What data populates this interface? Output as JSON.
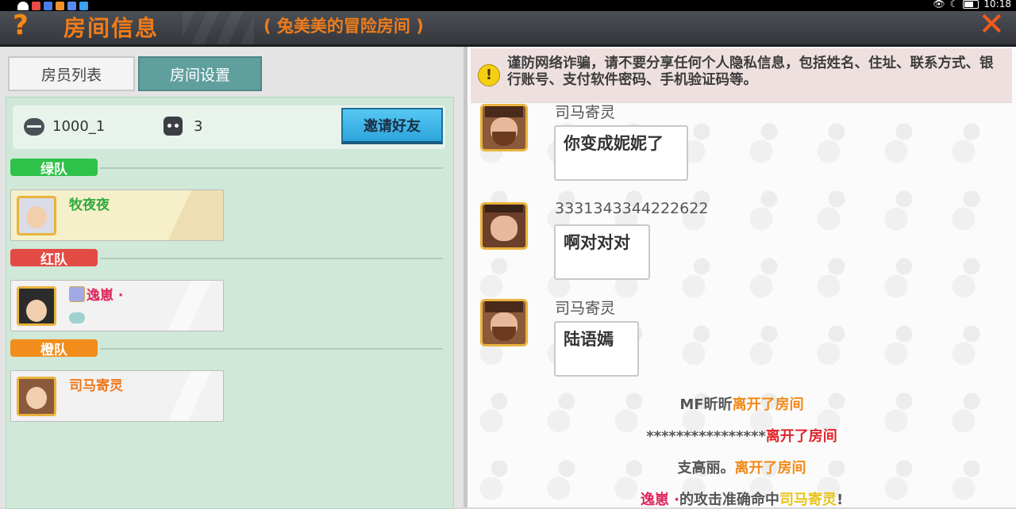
{
  "status_bar": {
    "time": "10:18"
  },
  "header": {
    "help_symbol": "?",
    "title": "房间信息",
    "subtitle": "( 兔美美的冒险房间 )",
    "close_symbol": "✕"
  },
  "tabs": [
    {
      "label": "房员列表",
      "active": false
    },
    {
      "label": "房间设置",
      "active": true
    }
  ],
  "room": {
    "room_id": "1000_1",
    "player_count": "3",
    "invite_label": "邀请好友"
  },
  "teams": [
    {
      "label": "绿队",
      "color": "#2fc24a",
      "members": [
        {
          "name": "牧夜夜",
          "name_color": "#2fa83d"
        }
      ]
    },
    {
      "label": "红队",
      "color": "#e34b45",
      "members": [
        {
          "name": "逸崽 ·",
          "name_color": "#e0245a"
        }
      ]
    },
    {
      "label": "橙队",
      "color": "#f28c1a",
      "members": [
        {
          "name": "司马寄灵",
          "name_color": "#f0781c"
        }
      ]
    }
  ],
  "chat": {
    "warning_icon": "!",
    "warning": "谨防网络诈骗，请不要分享任何个人隐私信息，包括姓名、住址、联系方式、银行账号、支付软件密码、手机验证码等。",
    "messages": [
      {
        "sender": "司马寄灵",
        "text": "你变成妮妮了"
      },
      {
        "sender": "333134334422262 2",
        "text": "啊对对对"
      },
      {
        "sender": "司马寄灵",
        "text": "陆语嫣"
      }
    ],
    "system": [
      {
        "who": "MF昕昕",
        "what": "离开了房间"
      },
      {
        "who": "****************",
        "what": "离开了房间"
      },
      {
        "who": "支高丽。",
        "what": "离开了房间"
      },
      {
        "who": "逸崽 ·",
        "mid": "的攻击准确命中",
        "target": "司马寄灵",
        "end": "!"
      }
    ]
  },
  "colors": {
    "accent": "#f07c1a",
    "invite": "#3bb3e8",
    "tab_active": "#5f9f9e"
  }
}
